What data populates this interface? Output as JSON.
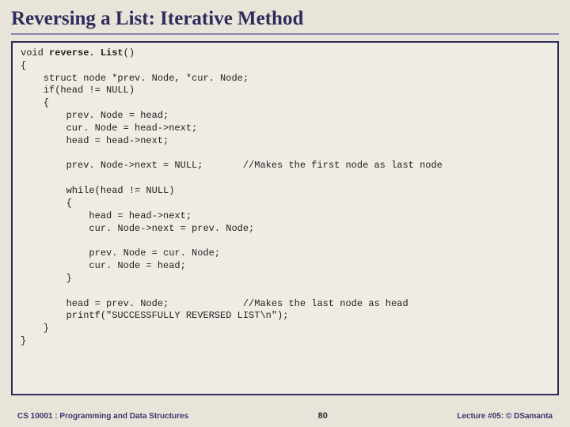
{
  "title": "Reversing a List: Iterative Method",
  "code": {
    "l01": "void ",
    "fn": "reverse. List",
    "l01b": "()",
    "l02": "{",
    "l03": "    struct node *prev. Node, *cur. Node;",
    "l04": "    if(head != NULL)",
    "l05": "    {",
    "l06": "        prev. Node = head;",
    "l07": "        cur. Node = head->next;",
    "l08": "        head = head->next;",
    "l09": "",
    "l10": "        prev. Node->next = NULL;       //Makes the first node as last node",
    "l11": "",
    "l12": "        while(head != NULL)",
    "l13": "        {",
    "l14": "            head = head->next;",
    "l15": "            cur. Node->next = prev. Node;",
    "l16": "",
    "l17": "            prev. Node = cur. Node;",
    "l18": "            cur. Node = head;",
    "l19": "        }",
    "l20": "",
    "l21": "        head = prev. Node;             //Makes the last node as head",
    "l22": "        printf(\"SUCCESSFULLY REVERSED LIST\\n\");",
    "l23": "    }",
    "l24": "}"
  },
  "footer": {
    "left": "CS 10001 : Programming and Data Structures",
    "page": "80",
    "right": "Lecture #05: © DSamanta"
  }
}
